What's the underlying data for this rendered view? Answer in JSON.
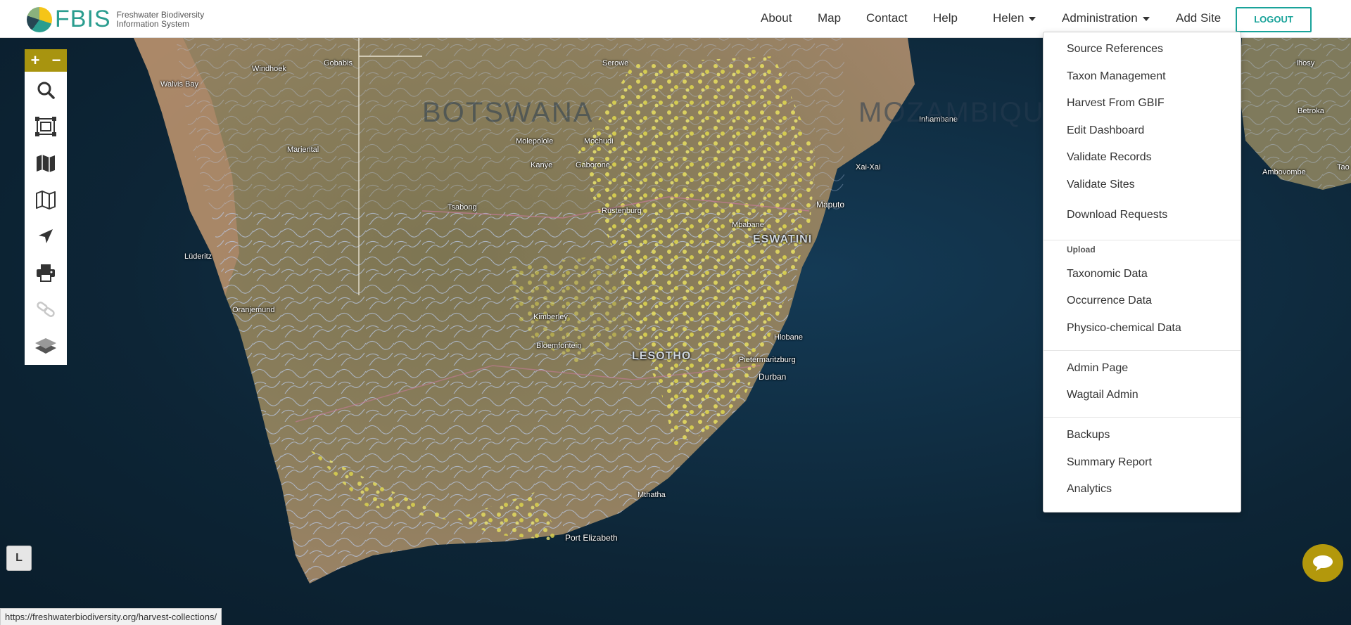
{
  "brand": {
    "logo_text": "FBIS",
    "subtitle_line1": "Freshwater Biodiversity",
    "subtitle_line2": "Information System"
  },
  "nav": {
    "about": "About",
    "map": "Map",
    "contact": "Contact",
    "help": "Help",
    "user": "Helen",
    "administration": "Administration",
    "add_site": "Add Site",
    "logout": "LOGOUT"
  },
  "admin_menu": {
    "items_group1": [
      "Source References",
      "Taxon Management",
      "Harvest From GBIF",
      "Edit Dashboard",
      "Validate Records",
      "Validate Sites",
      "Download Requests"
    ],
    "upload_header": "Upload",
    "items_upload": [
      "Taxonomic Data",
      "Occurrence Data",
      "Physico-chemical Data"
    ],
    "items_group3": [
      "Admin Page",
      "Wagtail Admin"
    ],
    "items_group4": [
      "Backups",
      "Summary Report",
      "Analytics"
    ]
  },
  "map": {
    "zoom_in": "+",
    "zoom_out": "−",
    "tools": [
      "search-icon",
      "select-area-icon",
      "map-filled-icon",
      "map-outline-icon",
      "locate-arrow-icon",
      "print-icon",
      "link-icon",
      "layers-icon"
    ],
    "places": [
      "Windhoek",
      "Gobabis",
      "Walvis Bay",
      "Serowe",
      "Mariental",
      "Molepolole",
      "Mochudi",
      "Kanye",
      "Gaborone",
      "Tsabong",
      "Lüderitz",
      "Rustenburg",
      "Oranjemund",
      "Kimberley",
      "Bloemfontein",
      "Maputo",
      "Inhambane",
      "Xai-Xai",
      "Ihosy",
      "Betroka",
      "Ambovombe",
      "Tao",
      "Durban",
      "Pietermaritzburg",
      "Port Elizabeth",
      "Mthatha",
      "Mbabane",
      "Hlobane"
    ],
    "region_labels": [
      "ESWATINI",
      "LESOTHO",
      "MOZAMBIQUE",
      "BOTSWANA"
    ],
    "legend_button": "L",
    "colors": {
      "land": "#8a7a58",
      "ocean": "#0d2536",
      "rivers": "#b9c9e8",
      "points": "#e8e060"
    }
  },
  "status_bar": {
    "url": "https://freshwaterbiodiversity.org/harvest-collections/"
  }
}
